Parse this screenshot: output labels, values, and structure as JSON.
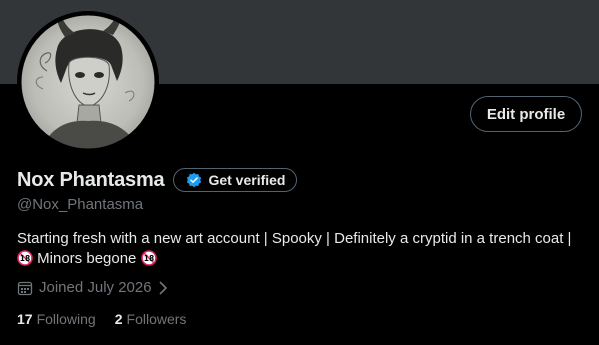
{
  "profile": {
    "display_name": "Nox Phantasma",
    "handle": "@Nox_Phantasma",
    "get_verified_label": "Get verified",
    "edit_profile_label": "Edit profile",
    "bio_text": "Starting fresh with a new art account | Spooky | Definitely a cryptid in a trench coat |",
    "bio_badge_text": "18",
    "bio_tail_text": "Minors begone",
    "joined_text": "Joined July 2026",
    "following_count": "17",
    "following_label": "Following",
    "followers_count": "2",
    "followers_label": "Followers"
  },
  "icons": {
    "verified": "verified-badge-icon",
    "calendar": "calendar-icon",
    "chevron": "chevron-right-icon",
    "no_under_18": "no-one-under-eighteen-icon"
  },
  "colors": {
    "background": "#000000",
    "banner": "#333639",
    "text_primary": "#e7e9ea",
    "text_secondary": "#71767b",
    "verified_blue": "#1d9bf0",
    "no18_red": "#e0245e"
  }
}
